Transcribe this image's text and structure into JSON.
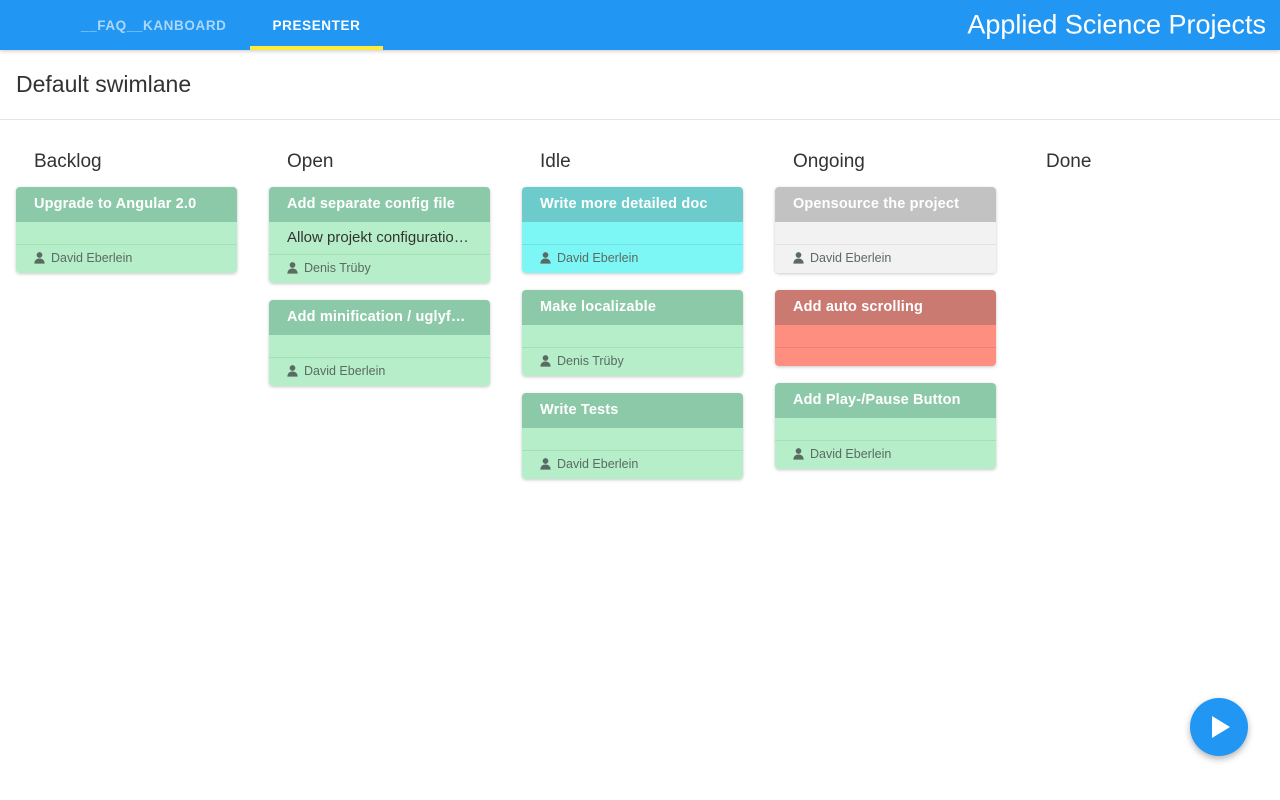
{
  "appbar": {
    "tabs": [
      {
        "label": "__FAQ__KANBOARD",
        "active": false
      },
      {
        "label": "PRESENTER",
        "active": true
      }
    ],
    "title": "Applied Science Projects",
    "background_color": "#2196f3",
    "active_underline_color": "#ffeb3b"
  },
  "swimlane": {
    "title": "Default swimlane"
  },
  "board": {
    "columns": [
      {
        "title": "Backlog",
        "cards": [
          {
            "title": "Upgrade to Angular 2.0",
            "description": "",
            "assignee": "David Eberlein",
            "assignee_icon": "user-icon",
            "color": "green"
          }
        ]
      },
      {
        "title": "Open",
        "cards": [
          {
            "title": "Add separate config file",
            "description": "Allow projekt configuration …",
            "assignee": "Denis Trüby",
            "assignee_icon": "user-icon",
            "color": "green"
          },
          {
            "title": "Add minification / uglyfying",
            "description": "",
            "assignee": "David Eberlein",
            "assignee_icon": "user-icon",
            "color": "green"
          }
        ]
      },
      {
        "title": "Idle",
        "cards": [
          {
            "title": "Write more detailed doc",
            "description": "",
            "assignee": "David Eberlein",
            "assignee_icon": "user-icon",
            "color": "cyan"
          },
          {
            "title": "Make localizable",
            "description": "",
            "assignee": "Denis Trüby",
            "assignee_icon": "user-icon",
            "color": "green"
          },
          {
            "title": "Write Tests",
            "description": "",
            "assignee": "David Eberlein",
            "assignee_icon": "user-icon",
            "color": "green"
          }
        ]
      },
      {
        "title": "Ongoing",
        "cards": [
          {
            "title": "Opensource the project",
            "description": "",
            "assignee": "David Eberlein",
            "assignee_icon": "user-icon",
            "color": "grey"
          },
          {
            "title": "Add auto scrolling",
            "description": "",
            "assignee": "",
            "assignee_icon": "",
            "color": "red"
          },
          {
            "title": "Add Play-/Pause Button",
            "description": "",
            "assignee": "David Eberlein",
            "assignee_icon": "user-icon",
            "color": "green"
          }
        ]
      },
      {
        "title": "Done",
        "cards": []
      }
    ]
  },
  "fab": {
    "icon": "play-icon",
    "color": "#2196f3"
  }
}
